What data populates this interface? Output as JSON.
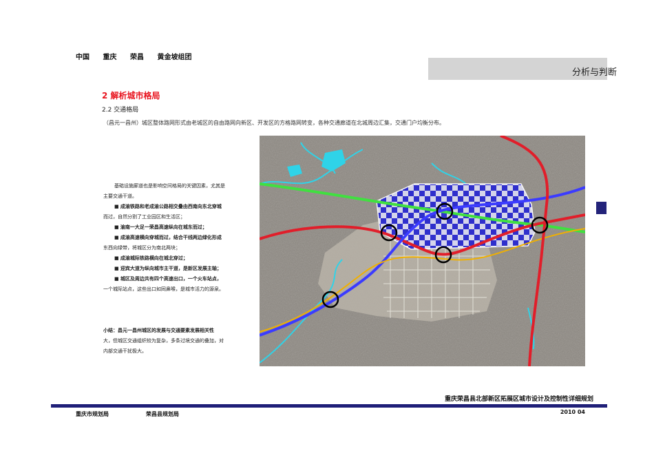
{
  "breadcrumb": [
    "中国",
    "重庆",
    "荣昌",
    "黄金坡组团"
  ],
  "header": {
    "title": "分析与判断"
  },
  "section": {
    "title": "2  解析城市格局",
    "subtitle": "2.2  交通格局"
  },
  "intro": "（昌元一昌州）城区整体路网形式由老城区的自由路网向新区、开发区的方格路网转变，各种交通廊道在北城周边汇集，交通门户均衡分布。",
  "notes": {
    "lead_1": "基础设施廊道也是影响空间格局的关键因素，尤其是",
    "lead_2": "主要交通干道。",
    "b1_1": "成渝铁路和老成渝公路相交叠由西南向东北穿城",
    "b1_2": "而过，自然分割了工业园区和生活区；",
    "b2": "渝南一大足一荣昌高速纵向在城东而过；",
    "b3_1": "成渝高速横向穿城而过，结合干线两边绿化形成",
    "b3_2": "东西向绿带，将城区分为南北两块；",
    "b4": "成渝城际铁路横向在城北穿过；",
    "b5": "迎宾大道为纵向城市主干道，是新区发展主轴；",
    "b6_1": "城区及周边共有四个高速出口，一个火车站点，",
    "b6_2": "一个城际站点，这些出口如同鼻喉，是城市活力的源泉。"
  },
  "summary": {
    "line_1": "小结：昌元一昌州城区的发展与交通要素发展相关性",
    "line_2": "大，但城区交通组织较为复杂，多条过境交通的叠加，对",
    "line_3": "内部交通干扰极大。"
  },
  "footer": {
    "project_title": "重庆荣昌县北部新区拓展区城市设计及控制性详细规划",
    "org_1": "重庆市规划局",
    "org_2": "荣昌县规划局",
    "date": "2010  04"
  },
  "colors": {
    "accent_red": "#e8141e",
    "footer_navy": "#1f1f78",
    "header_band": "#d4d4d4"
  }
}
